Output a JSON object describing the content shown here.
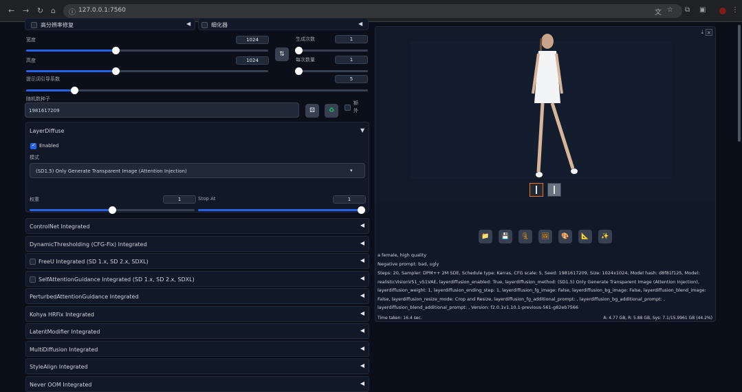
{
  "browser": {
    "url": "127.0.0.1:7560",
    "nav_icons": [
      "back-icon",
      "forward-icon",
      "reload-icon",
      "home-icon"
    ]
  },
  "top": {
    "left_dropdown_label": "高分辨率修复",
    "right_dropdown_label": "细化器"
  },
  "sizes": {
    "width_label": "宽度",
    "width_value": "1024",
    "width_fraction": 0.37,
    "height_label": "高度",
    "height_value": "1024",
    "height_fraction": 0.37,
    "swap_icon": "⇅",
    "batch_count_label": "生成次数",
    "batch_count_value": "1",
    "batch_size_label": "每次数量",
    "batch_size_value": "1",
    "cfg_label": "提示词引导系数",
    "cfg_value": "5",
    "cfg_fraction": 0.14
  },
  "seed": {
    "label": "随机数种子",
    "value": "1981617209",
    "dice_icon": "dice-icon",
    "recycle_icon": "recycle-icon",
    "extra_label_1": "额",
    "extra_label_2": "外"
  },
  "layerdiffuse": {
    "title": "LayerDiffuse",
    "enabled_label": "Enabled",
    "mode_label": "模式",
    "mode_value": "(SD1.5) Only Generate Transparent Image (Attention Injection)",
    "weight_label": "权重",
    "weight_value": "1",
    "stop_at_label": "Stop At",
    "stop_at_value": "1"
  },
  "accordions": [
    {
      "label": "ControlNet Integrated",
      "checkbox": false
    },
    {
      "label": "DynamicThresholding (CFG-Fix) Integrated",
      "checkbox": false
    },
    {
      "label": "FreeU Integrated (SD 1.x, SD 2.x, SDXL)",
      "checkbox": true
    },
    {
      "label": "SelfAttentionGuidance Integrated (SD 1.x, SD 2.x, SDXL)",
      "checkbox": true
    },
    {
      "label": "PerturbedAttentionGuidance Integrated",
      "checkbox": false
    },
    {
      "label": "Kohya HRFix Integrated",
      "checkbox": false
    },
    {
      "label": "LatentModifier Integrated",
      "checkbox": false
    },
    {
      "label": "MultiDiffusion Integrated",
      "checkbox": false
    },
    {
      "label": "StyleAlign Integrated",
      "checkbox": false
    },
    {
      "label": "Never OOM Integrated",
      "checkbox": false
    }
  ],
  "output": {
    "prompt": "a female, high quality",
    "negative": "Negative prompt: bad, ugly",
    "params_lines": [
      "Steps: 20, Sampler: DPM++ 2M SDE, Schedule type: Karras, CFG scale: 5, Seed: 1981617209, Size: 1024x1024, Model hash: d8f81f125, Model:",
      "realisticVisionV51_v51VAE, layerdiffusion_enabled: True, layerdiffusion_method: (SD1.5) Only Generate Transparent Image (Attention Injection),",
      "layerdiffusion_weight: 1, layerdiffusion_ending_step: 1, layerdiffusion_fg_image: False, layerdiffusion_bg_image: False, layerdiffusion_blend_image:",
      "False, layerdiffusion_resize_mode: Crop and Resize, layerdiffusion_fg_additional_prompt: , layerdiffusion_bg_additional_prompt: ,",
      "layerdiffusion_blend_additional_prompt: , Version: f2.0.1v1.10.1-previous-561-g82eb7566"
    ],
    "time_taken": "Time taken: 16.4 sec.",
    "vram": "A: 4.77 GB, R: 5.88 GB, Sys: 7.1/15.9961 GB (44.2%)",
    "tools": [
      "folder-icon",
      "save-icon",
      "zip-icon",
      "image-icon",
      "palette-icon",
      "triangle-ruler-icon",
      "sparkle-icon"
    ],
    "tool_glyphs": [
      "📁",
      "💾",
      "🗜",
      "🖼",
      "🎨",
      "📐",
      "✨"
    ]
  }
}
